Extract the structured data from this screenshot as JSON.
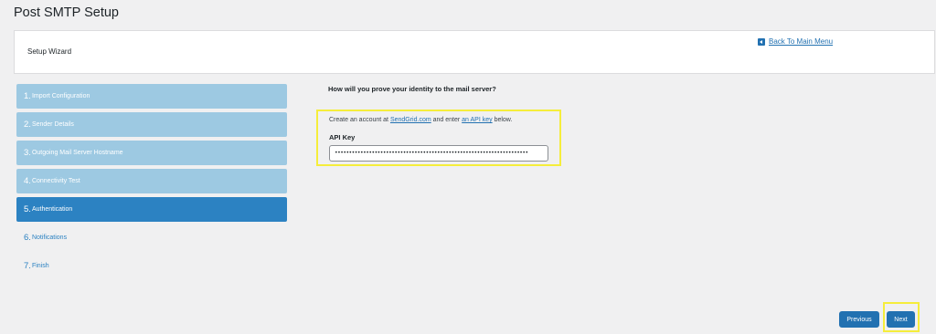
{
  "page": {
    "title": "Post SMTP Setup"
  },
  "header": {
    "wizard_title": "Setup Wizard",
    "back_link": "Back To Main Menu"
  },
  "steps": [
    {
      "num": "1.",
      "label": "Import Configuration",
      "state": "completed"
    },
    {
      "num": "2.",
      "label": "Sender Details",
      "state": "completed"
    },
    {
      "num": "3.",
      "label": "Outgoing Mail Server Hostname",
      "state": "completed"
    },
    {
      "num": "4.",
      "label": "Connectivity Test",
      "state": "completed"
    },
    {
      "num": "5.",
      "label": "Authentication",
      "state": "active"
    },
    {
      "num": "6.",
      "label": "Notifications",
      "state": "pending"
    },
    {
      "num": "7.",
      "label": "Finish",
      "state": "pending"
    }
  ],
  "auth": {
    "question": "How will you prove your identity to the mail server?",
    "create_prefix": "Create an account at ",
    "sendgrid_link": "SendGrid.com",
    "create_middle": " and enter ",
    "api_key_link": "an API key",
    "create_suffix": " below.",
    "api_label": "API Key",
    "api_value": "••••••••••••••••••••••••••••••••••••••••••••••••••••••••••••••••••••"
  },
  "buttons": {
    "previous": "Previous",
    "next": "Next"
  },
  "colors": {
    "accent": "#2271b1",
    "active_step": "#2c82c2",
    "completed_step": "#9dc9e2",
    "highlight": "#f5ed3b"
  }
}
